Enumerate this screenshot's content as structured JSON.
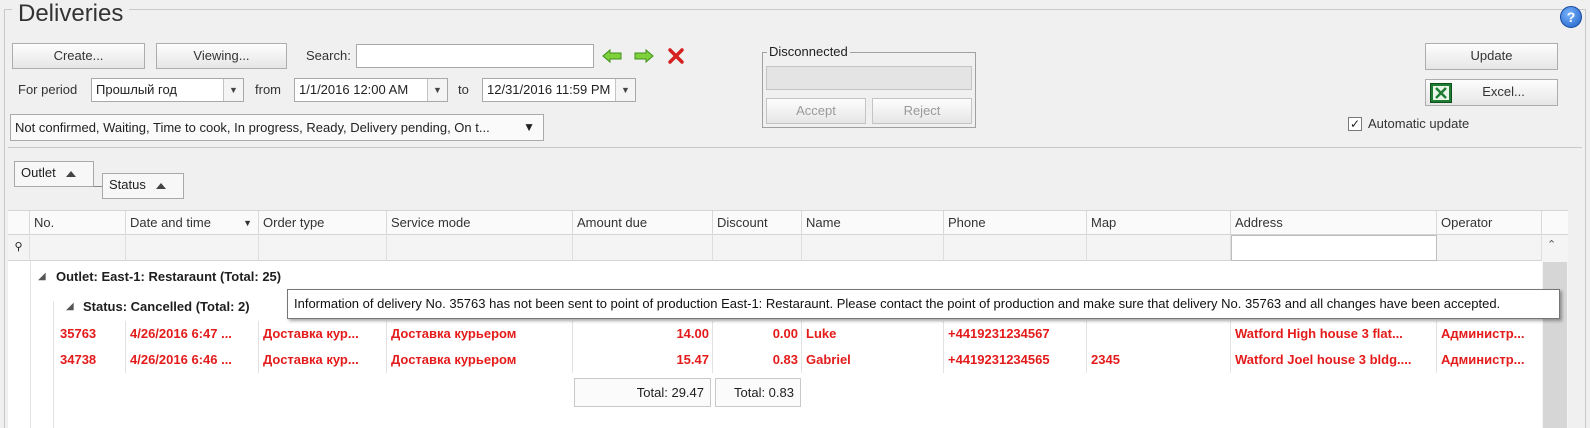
{
  "title": "Deliveries",
  "help": "?",
  "toolbar": {
    "create": "Create...",
    "viewing": "Viewing...",
    "search_label": "Search:",
    "search_value": "",
    "period_label": "For period",
    "period_value": "Прошлый год",
    "from_label": "from",
    "from_value": "1/1/2016 12:00 AM",
    "to_label": "to",
    "to_value": "12/31/2016 11:59 PM",
    "status_filter": "Not confirmed, Waiting, Time to cook, In progress, Ready, Delivery pending, On t...",
    "update": "Update",
    "excel": "Excel...",
    "auto_update": "Automatic update",
    "auto_update_checked": true
  },
  "connection": {
    "title": "Disconnected",
    "accept": "Accept",
    "reject": "Reject"
  },
  "grouping": {
    "outlet": "Outlet",
    "status": "Status"
  },
  "columns": [
    "No.",
    "Date and time",
    "Order type",
    "Service mode",
    "Amount due",
    "Discount",
    "Name",
    "Phone",
    "Map",
    "Address",
    "Operator"
  ],
  "group_outlet": "Outlet: East-1: Restaraunt (Total: 25)",
  "group_status": "Status: Cancelled (Total: 2)",
  "rows": [
    {
      "no": "35763",
      "date": "4/26/2016 6:47 ...",
      "order_type": "Доставка кур...",
      "service_mode": "Доставка курьером",
      "amount": "14.00",
      "discount": "0.00",
      "name": "Luke",
      "phone": "+4419231234567",
      "map": "",
      "address": "Watford High house 3 flat...",
      "operator": "Администр..."
    },
    {
      "no": "34738",
      "date": "4/26/2016 6:46 ...",
      "order_type": "Доставка кур...",
      "service_mode": "Доставка курьером",
      "amount": "15.47",
      "discount": "0.83",
      "name": "Gabriel",
      "phone": "+4419231234565",
      "map": "2345",
      "address": "Watford Joel house 3 bldg....",
      "operator": "Администр..."
    }
  ],
  "totals": {
    "amount": "Total: 29.47",
    "discount": "Total: 0.83"
  },
  "tooltip": "Information of delivery No. 35763 has not been sent to point of production  East-1: Restaraunt.  Please contact the point of production and make sure that delivery No. 35763 and all changes have been accepted."
}
